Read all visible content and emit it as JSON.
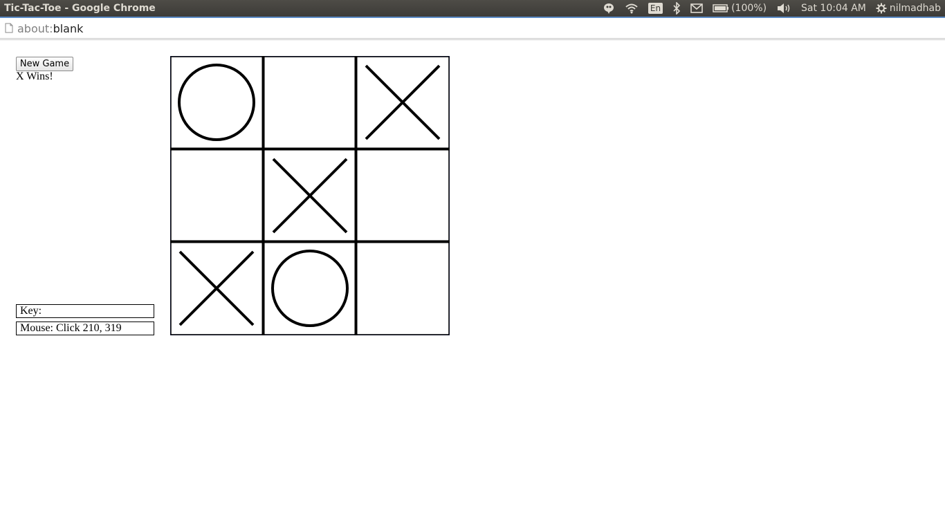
{
  "window": {
    "title": "Tic-Tac-Toe - Google Chrome"
  },
  "panel": {
    "keyboard_layout": "En",
    "battery_text": "(100%)",
    "clock": "Sat 10:04 AM",
    "username": "nilmadhab",
    "icons": [
      "chat-icon",
      "wifi-icon",
      "keyboard-layout-icon",
      "bluetooth-icon",
      "mail-icon",
      "battery-icon",
      "volume-icon",
      "gear-icon"
    ]
  },
  "browser": {
    "url_scheme": "about:",
    "url_path": "blank"
  },
  "game": {
    "new_game_label": "New Game",
    "status": "X Wins!",
    "key_readout": "Key:",
    "mouse_readout": "Mouse: Click 210, 319",
    "board": [
      [
        "O",
        "",
        "X"
      ],
      [
        "",
        "X",
        ""
      ],
      [
        "X",
        "O",
        ""
      ]
    ]
  }
}
